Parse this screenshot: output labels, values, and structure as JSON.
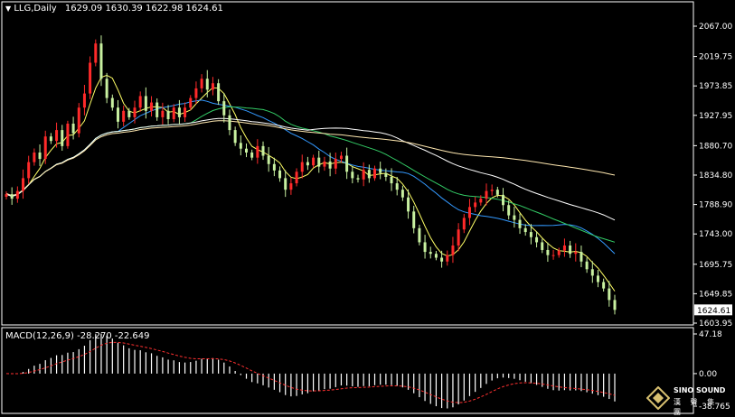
{
  "window": {
    "symbol_label": "LLG,Daily",
    "ohlc_text": "1629.09 1630.39 1622.98 1624.61"
  },
  "macd_panel": {
    "label": "MACD(12,26,9) -28.270 -22.649",
    "main_value": -28.27,
    "signal_value": -22.649
  },
  "brand": {
    "logo_text": "SINO SOUND",
    "logo_sub": "漢 聲 集 團"
  },
  "colors": {
    "background": "#000000",
    "bull_candle": "#ff2a2a",
    "bear_candle": "#c8f0a0",
    "ma_fast": "#ffff66",
    "ma_mid": "#3399ff",
    "ma_slow": "#33cc66",
    "ma_long": "#ffffff",
    "ma_longest": "#ffe8b0",
    "macd_hist": "#ffffff",
    "macd_signal": "#ff3030",
    "current_price_box": "#ffffff"
  },
  "chart_data": [
    {
      "type": "candlestick",
      "title": "LLG,Daily",
      "last_price": 1624.61,
      "ylim": [
        1603.95,
        2090
      ],
      "yticks": [
        2067.0,
        2019.75,
        1973.85,
        1927.95,
        1880.7,
        1834.8,
        1788.9,
        1743.0,
        1695.75,
        1649.85,
        1603.95
      ],
      "ytick_labels": [
        "2067.00",
        "2019.75",
        "1973.85",
        "1927.95",
        "1880.70",
        "1834.80",
        "1788.90",
        "1743.00",
        "1695.75",
        "1649.85",
        "1603.95"
      ],
      "closes": [
        1805,
        1798,
        1810,
        1830,
        1855,
        1870,
        1860,
        1895,
        1888,
        1905,
        1880,
        1915,
        1900,
        1940,
        1962,
        2010,
        2040,
        1985,
        1955,
        1940,
        1918,
        1935,
        1925,
        1940,
        1958,
        1935,
        1948,
        1925,
        1935,
        1922,
        1940,
        1925,
        1940,
        1955,
        1970,
        1985,
        1968,
        1978,
        1950,
        1928,
        1905,
        1885,
        1876,
        1870,
        1862,
        1880,
        1865,
        1852,
        1842,
        1830,
        1812,
        1822,
        1840,
        1855,
        1850,
        1862,
        1848,
        1856,
        1845,
        1860,
        1865,
        1840,
        1830,
        1828,
        1843,
        1830,
        1845,
        1838,
        1832,
        1822,
        1812,
        1800,
        1778,
        1752,
        1730,
        1715,
        1712,
        1706,
        1700,
        1710,
        1725,
        1750,
        1768,
        1785,
        1792,
        1798,
        1810,
        1812,
        1804,
        1788,
        1772,
        1765,
        1752,
        1746,
        1738,
        1730,
        1718,
        1710,
        1710,
        1717,
        1725,
        1712,
        1715,
        1700,
        1688,
        1678,
        1668,
        1658,
        1640,
        1624.61
      ],
      "series": [
        {
          "name": "MA",
          "period": 5
        },
        {
          "name": "MA",
          "period": 21
        },
        {
          "name": "MA",
          "period": 34
        },
        {
          "name": "MA",
          "period": 55
        },
        {
          "name": "MA",
          "period": 120
        }
      ]
    },
    {
      "type": "bar",
      "title": "MACD(12,26,9) -28.270 -22.649",
      "ylim": [
        -38.765,
        47.18
      ],
      "yticks": [
        47.18,
        0.0,
        -38.765
      ],
      "ytick_labels": [
        "47.18",
        "0.00",
        "-38.765"
      ]
    }
  ]
}
